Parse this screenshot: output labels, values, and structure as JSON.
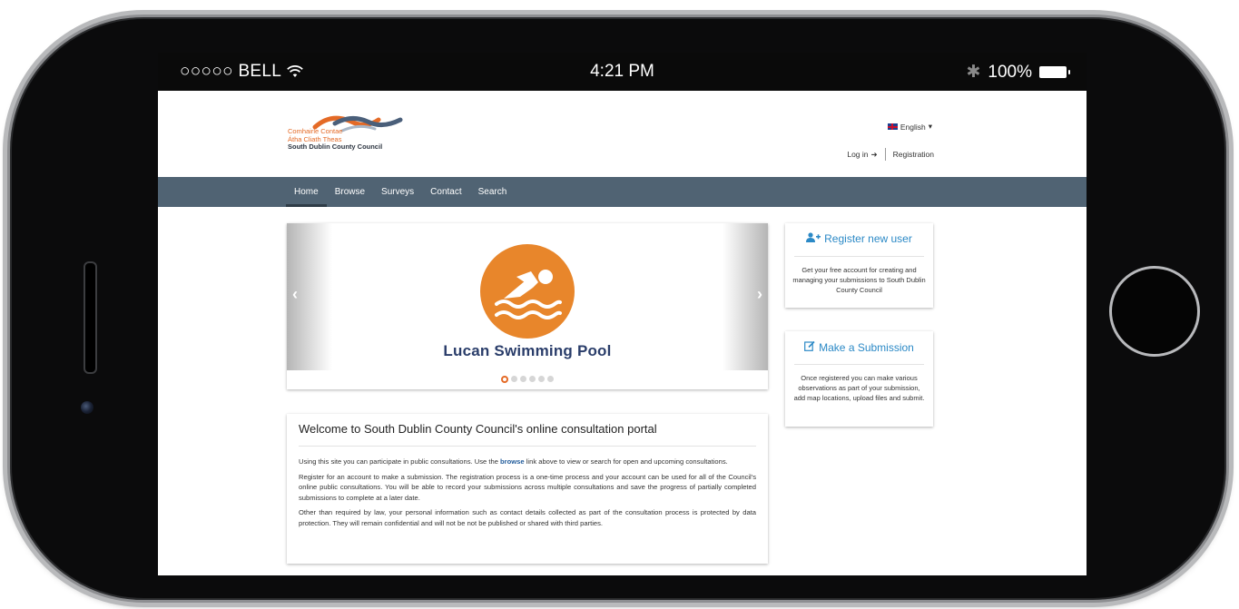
{
  "statusbar": {
    "carrier": "○○○○○ BELL",
    "time": "4:21 PM",
    "battery": "100%"
  },
  "logo": {
    "line1": "Comhairle Contae",
    "line2": "Átha Cliath Theas",
    "line3": "South Dublin County Council"
  },
  "header": {
    "language": "English",
    "login": "Log in",
    "registration": "Registration"
  },
  "nav": {
    "items": [
      {
        "label": "Home",
        "active": true
      },
      {
        "label": "Browse",
        "active": false
      },
      {
        "label": "Surveys",
        "active": false
      },
      {
        "label": "Contact",
        "active": false
      },
      {
        "label": "Search",
        "active": false
      }
    ]
  },
  "carousel": {
    "title": "Lucan Swimming Pool",
    "slide_count": 6,
    "active_index": 0,
    "prev_symbol": "‹",
    "next_symbol": "›"
  },
  "welcome": {
    "title": "Welcome to South Dublin County Council's online consultation portal",
    "p1_before": "Using this site you can participate in public consultations. Use the ",
    "p1_link": "browse",
    "p1_after": " link above to view or search for open and upcoming consultations.",
    "p2": "Register for an account to make a submission. The registration process is a one-time process and your account can be used for all of the Council's online public consultations. You will be able to record your submissions across multiple consultations and save the progress of partially completed submissions to complete at a later date.",
    "p3": "Other than required by law, your personal information such as contact details collected as part of the consultation process is protected by data protection. They will remain confidential and will not be not be published or shared with third parties."
  },
  "cards": {
    "register": {
      "title": "Register new user",
      "text": "Get your free account for creating and managing your submissions to South Dublin County Council"
    },
    "submission": {
      "title": "Make a Submission",
      "text": "Once registered you can make various observations as part of your submission, add map locations, upload files and submit."
    }
  },
  "colors": {
    "navbar": "#506373",
    "accent_orange": "#e8862b",
    "link_blue": "#2b89c6",
    "slide_title": "#2a3d6a"
  }
}
